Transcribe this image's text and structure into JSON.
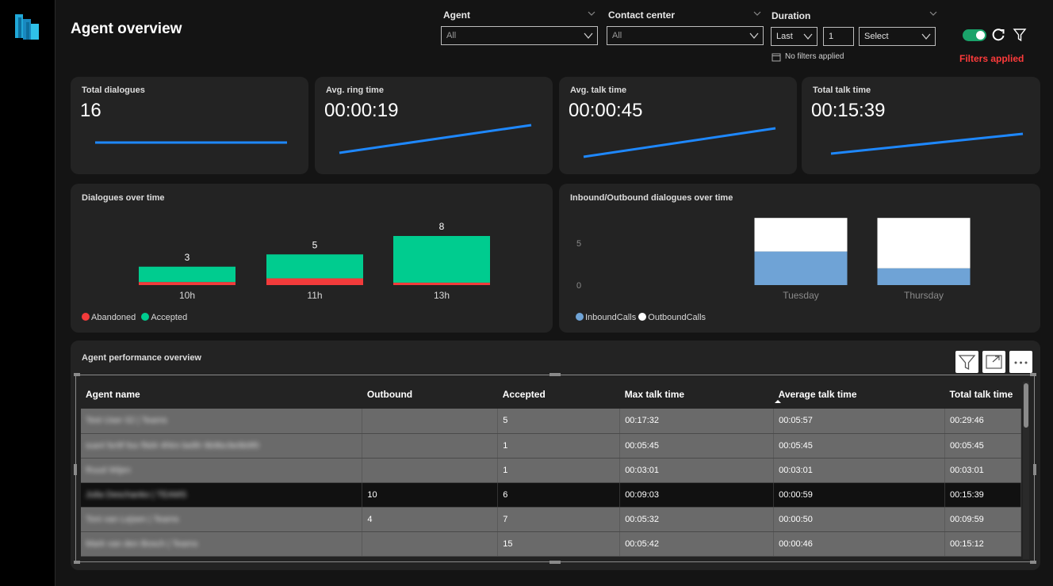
{
  "page": {
    "title": "Agent overview"
  },
  "slicers": {
    "agent": {
      "label": "Agent",
      "value": "All"
    },
    "contact_center": {
      "label": "Contact center",
      "value": "All"
    },
    "duration": {
      "label": "Duration",
      "period": "Last",
      "count": "1",
      "unit": "Select",
      "status": "No filters applied"
    }
  },
  "header": {
    "filters_applied": "Filters applied"
  },
  "kpis": [
    {
      "title": "Total dialogues",
      "value": "16"
    },
    {
      "title": "Avg. ring time",
      "value": "00:00:19"
    },
    {
      "title": "Avg. talk time",
      "value": "00:00:45"
    },
    {
      "title": "Total talk time",
      "value": "00:15:39"
    }
  ],
  "dialogues_chart": {
    "title": "Dialogues over time",
    "chart_data": {
      "type": "bar",
      "stacked": true,
      "categories": [
        "10h",
        "11h",
        "13h"
      ],
      "series": [
        {
          "name": "Abandoned",
          "values": [
            0.5,
            1.1,
            0.4
          ],
          "color": "#f23b3b"
        },
        {
          "name": "Accepted",
          "values": [
            2.5,
            3.9,
            7.6
          ],
          "color": "#00cc8f"
        }
      ],
      "totals": [
        "3",
        "5",
        "8"
      ],
      "legend": "bottom-left"
    }
  },
  "inout_chart": {
    "title": "Inbound/Outbound dialogues over time",
    "chart_data": {
      "type": "bar",
      "stacked": true,
      "categories": [
        "Tuesday",
        "Thursday"
      ],
      "y_ticks": [
        "0",
        "5"
      ],
      "ylim": [
        0,
        8
      ],
      "series": [
        {
          "name": "InboundCalls",
          "values": [
            4,
            2
          ],
          "color": "#6fa3d6"
        },
        {
          "name": "OutboundCalls",
          "values": [
            4,
            6
          ],
          "color": "#ffffff"
        }
      ],
      "legend": "bottom-left"
    }
  },
  "table": {
    "title": "Agent performance overview",
    "columns": [
      "Agent name",
      "Outbound",
      "Accepted",
      "Max talk time",
      "Average talk time",
      "Total talk time"
    ],
    "rows": [
      {
        "name": "Test User 02 | Teams",
        "outbound": "",
        "accepted": "5",
        "max": "00:17:32",
        "avg": "00:05:57",
        "total": "00:29:46"
      },
      {
        "name": "sue4 fsr9f foo f9d4 4f4m be8h 9b9bc9e9b9f0",
        "outbound": "",
        "accepted": "1",
        "max": "00:05:45",
        "avg": "00:05:45",
        "total": "00:05:45"
      },
      {
        "name": "Ruud Wijen",
        "outbound": "",
        "accepted": "1",
        "max": "00:03:01",
        "avg": "00:03:01",
        "total": "00:03:01"
      },
      {
        "name": "Julia Deschanko | TEAMS",
        "outbound": "10",
        "accepted": "6",
        "max": "00:09:03",
        "avg": "00:00:59",
        "total": "00:15:39"
      },
      {
        "name": "Toni van Lejsen | Teams",
        "outbound": "4",
        "accepted": "7",
        "max": "00:05:32",
        "avg": "00:00:50",
        "total": "00:09:59"
      },
      {
        "name": "Mark van den Bosch | Teams",
        "outbound": "",
        "accepted": "15",
        "max": "00:05:42",
        "avg": "00:00:46",
        "total": "00:15:12"
      }
    ],
    "selected_row": 3,
    "sort_column": "Average talk time"
  },
  "icons": {
    "logo": "app-logo-icon",
    "refresh": "refresh-icon",
    "filter": "filter-icon",
    "focus": "focus-mode-icon",
    "more": "more-options-icon"
  }
}
